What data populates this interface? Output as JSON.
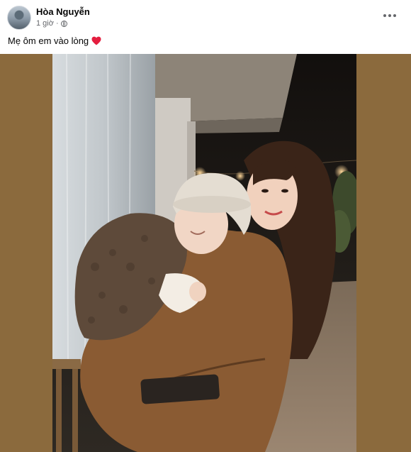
{
  "post": {
    "author": "Hòa Nguyễn",
    "time": "1 giờ",
    "separator": "·",
    "caption": "Mẹ ôm em vào lòng",
    "more_icon": "more-options-icon",
    "privacy_icon": "globe-icon",
    "heart_icon": "red-heart-icon",
    "colors": {
      "heart": "#e41e3f",
      "background_frame": "#8b6a3d",
      "name": "#050505",
      "meta": "#65676b"
    }
  }
}
